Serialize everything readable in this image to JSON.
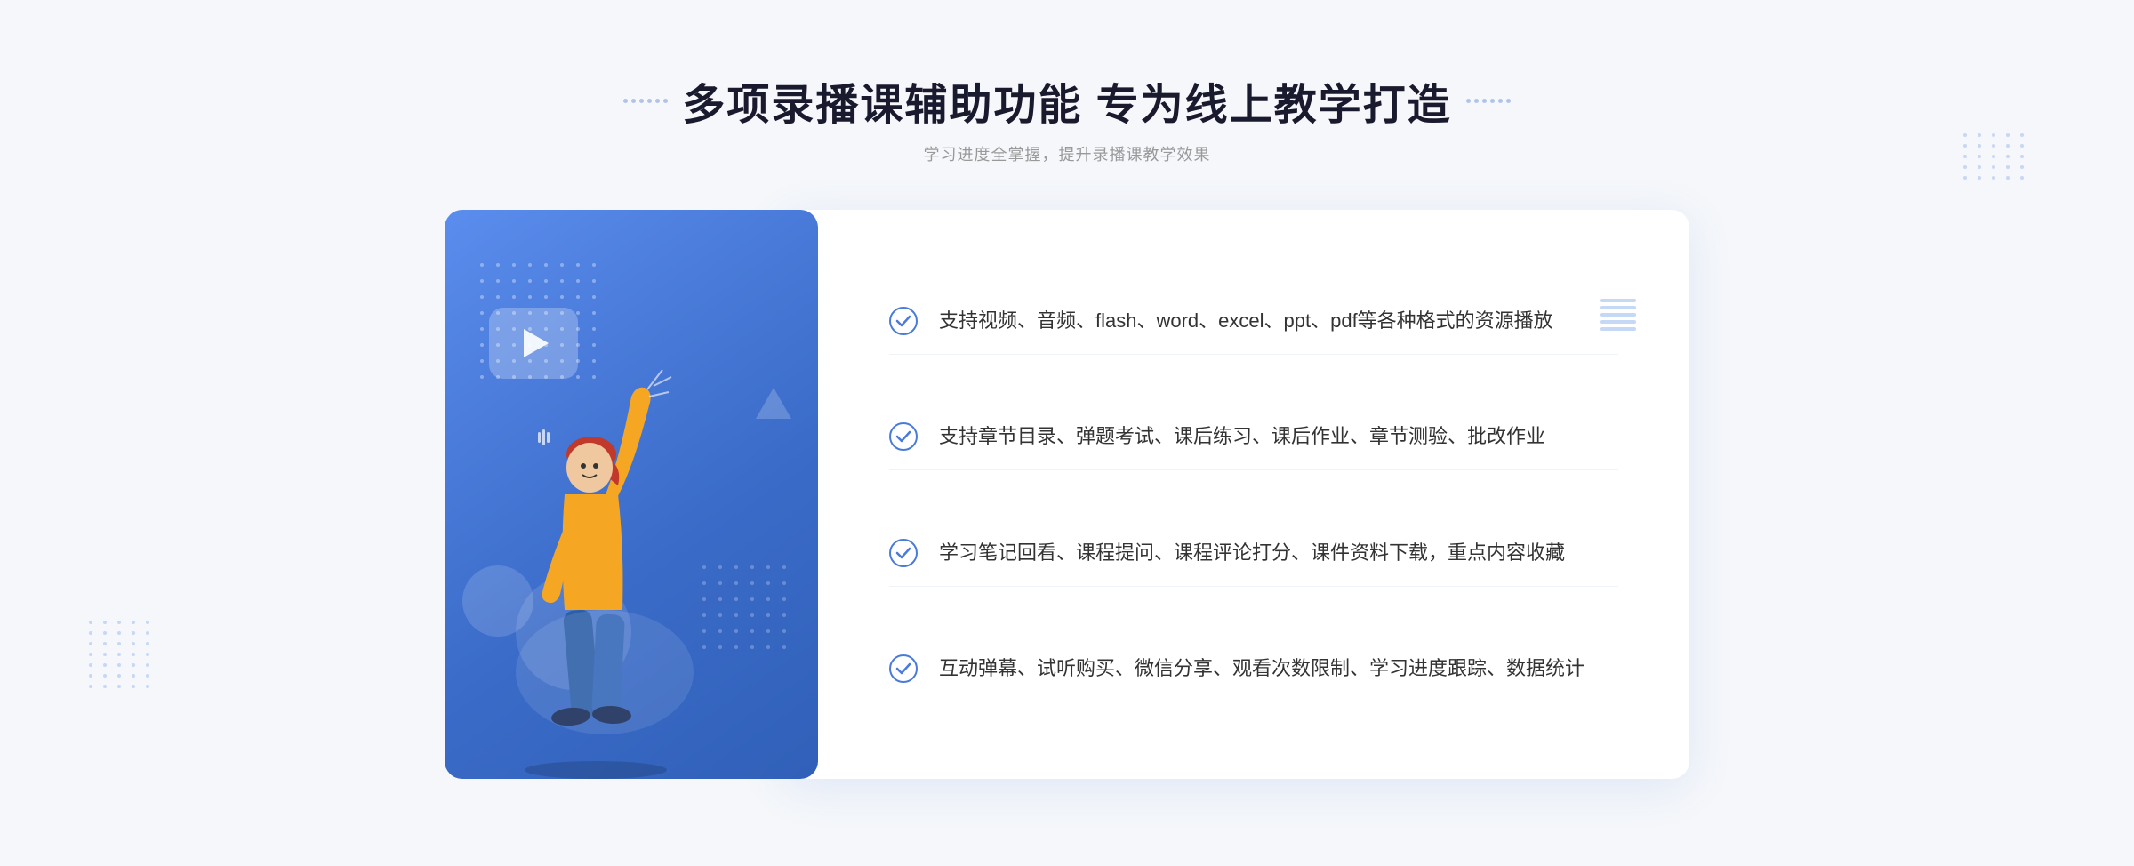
{
  "header": {
    "title": "多项录播课辅助功能 专为线上教学打造",
    "subtitle": "学习进度全掌握，提升录播课教学效果"
  },
  "features": [
    {
      "id": "feature-1",
      "text": "支持视频、音频、flash、word、excel、ppt、pdf等各种格式的资源播放"
    },
    {
      "id": "feature-2",
      "text": "支持章节目录、弹题考试、课后练习、课后作业、章节测验、批改作业"
    },
    {
      "id": "feature-3",
      "text": "学习笔记回看、课程提问、课程评论打分、课件资料下载，重点内容收藏"
    },
    {
      "id": "feature-4",
      "text": "互动弹幕、试听购买、微信分享、观看次数限制、学习进度跟踪、数据统计"
    }
  ],
  "decorators": {
    "left_chevron": "»",
    "accent_color": "#4a7bda"
  }
}
